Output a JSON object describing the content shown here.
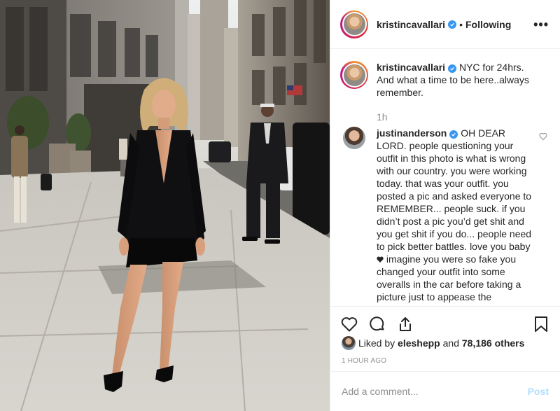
{
  "post": {
    "author": "kristincavallari",
    "follow_status": "Following",
    "separator": "•",
    "more_label": "•••"
  },
  "caption": {
    "username": "kristincavallari",
    "text": "NYC for 24hrs. And what a time to be here..always remember.",
    "time": "1h"
  },
  "comment": {
    "username": "justinanderson",
    "text_before_heart": "OH DEAR LORD. people questioning your outfit in this photo is what is wrong with our country. you were working today. that was your outfit. you posted a pic and asked everyone to REMEMBER... people suck. if you didn’t post a pic you’d get shit and you get shit if you do... people need to pick better battles. love you baby",
    "text_after_heart": "imagine you were so fake you changed your outfit into some overalls in the car before taking a picture just to appease the"
  },
  "likes": {
    "prefix": "Liked by",
    "user": "eleshepp",
    "joiner": "and",
    "count_text": "78,186 others"
  },
  "timestamp": "1 HOUR AGO",
  "composer": {
    "placeholder": "Add a comment...",
    "post_label": "Post"
  },
  "icons": {
    "like": "heart-icon",
    "comment": "comment-icon",
    "share": "share-icon",
    "save": "bookmark-icon",
    "verified": "verified-badge-icon"
  },
  "colors": {
    "verified": "#3897f0",
    "post_button_disabled": "#b2dffc",
    "muted_text": "#8e8e8e"
  }
}
